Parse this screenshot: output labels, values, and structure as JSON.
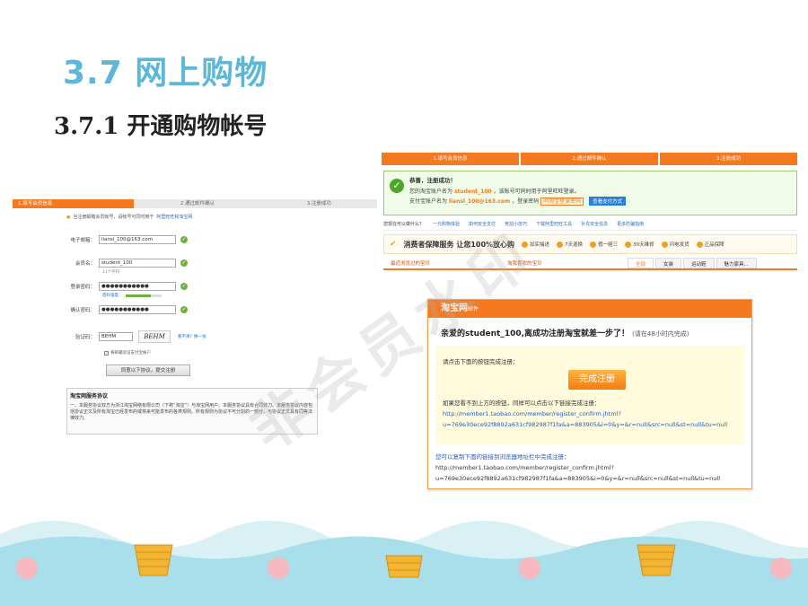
{
  "slide": {
    "title": "3.7  网上购物",
    "subtitle": "3.7.1  开通购物帐号",
    "watermark": "非会员水印"
  },
  "left_form": {
    "steps": [
      "1.填写会员信息",
      "2.通过邮件确认",
      "3.注册成功"
    ],
    "tip": "当注册邮箱会员帐号，请帐号可同时用于",
    "tip_link": "阿里旺旺和淘宝网",
    "fields": [
      {
        "label": "电子邮箱：",
        "value": "liansl_100@163.com"
      },
      {
        "label": "会员名：",
        "value": "student_100",
        "hint": "11个字符"
      },
      {
        "label": "登录密码：",
        "value": "●●●●●●●●●●●",
        "hint": "密码强度："
      },
      {
        "label": "确认密码：",
        "value": "●●●●●●●●●●●"
      }
    ],
    "captcha_label": "验证码：",
    "captcha_value": "BEHM",
    "captcha_image_text": "BEHM",
    "captcha_refresh": "看不清？换一张",
    "checkbox_label": "将邮箱验证支付宝帐户",
    "submit_label": "同意以下协议，提交注册",
    "agreement_title": "淘宝网服务协议",
    "agreement_text": "一、本服务协议双方为浙江淘宝网络有限公司（下称“淘宝”）与淘宝网用户。本服务协议具有合同效力。本服务协议内容包括协议正文及所有淘宝已经发布的或将来可能发布的各类规则。所有规则为协议不可分割的一部分，与协议正文具有同等法律效力。"
  },
  "right_page": {
    "steps": [
      "1.填写会员信息",
      "2.通过邮件确认",
      "3.注册成功"
    ],
    "success_heading": "恭喜，注册成功！",
    "line1_prefix": "您的淘宝账户名为",
    "line1_name": "student_100",
    "line1_suffix": "，该账号可同时用于阿里旺旺登录。",
    "line2_prefix": "支付宝账户名为",
    "line2_name": "liansl_100@163.com",
    "line2_suffix": "，登录密码",
    "line2_tag": "同淘宝登录密码",
    "pay_button": "查看支付方式",
    "links": [
      "您现在可以做什么？",
      "一元购物体验",
      "如何安全支付",
      "竞拍小技巧",
      "下载阿里旺旺工具",
      "补充安全信息",
      "更多防骗指南"
    ],
    "guarantee_title": "消费者保障服务  让您100%放心购",
    "guarantee_items": [
      "如实描述",
      "7天退换",
      "假一赔三",
      "30天维修",
      "闪电发货",
      "正品保障"
    ],
    "recent_label": "最近浏览过的宝贝",
    "fav_label": "淘我喜欢的宝贝",
    "tabs": [
      "全部",
      "女装",
      "运动鞋",
      "魅力家具..."
    ]
  },
  "email": {
    "brand": "淘宝网",
    "brand_sub": "邮件",
    "title": "亲爱的student_100,离成功注册淘宝就差一步了！",
    "title_note": "(请在48小时内完成)",
    "instruction": "请点击下面的按钮完成注册：",
    "confirm_button": "完成注册",
    "fallback_text": "如果您看不到上方的按钮，同样可以点击以下链接完成注册：",
    "link_line1": "http://member1.taobao.com/member/register_confirm.jhtml?",
    "link_line2": "u=769e30ece92f8892a631cf982987f1fa&a=883905&i=0&y=&r=null&src=null&st=null&tu=null",
    "copy_text": "您可以复制下面的链接到浏览器地址栏中完成注册：",
    "copy_line1": "http://member1.taobao.com/member/register_confirm.jhtml?",
    "copy_line2": "u=769e30ece92f8892a631cf982987f1fa&a=883905&i=0&y=&r=null&src=null&st=null&tu=null"
  },
  "colors": {
    "title": "#5bb8d6",
    "orange": "#f47920",
    "success_green": "#4da52c",
    "link_blue": "#2a5cb0",
    "bottom_band": "#a8dfea"
  }
}
